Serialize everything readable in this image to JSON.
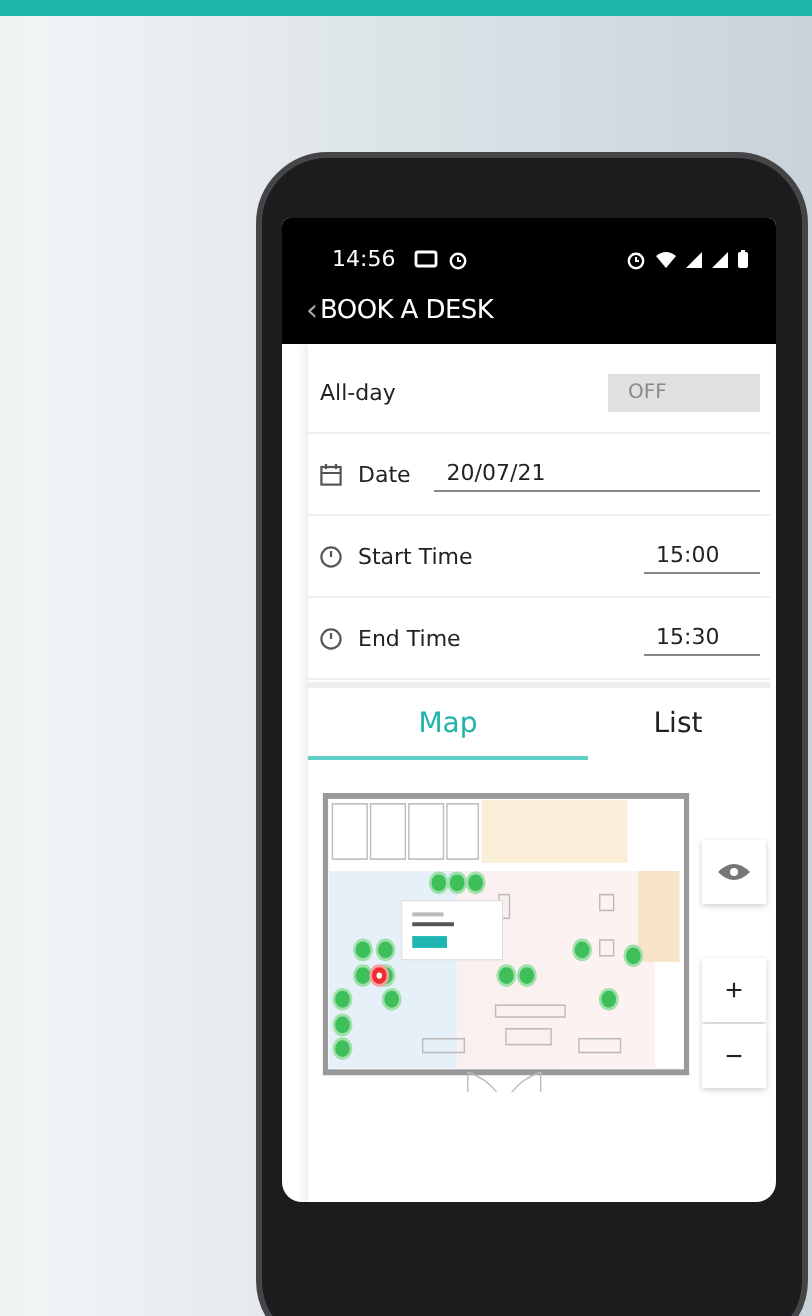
{
  "status_bar": {
    "time": "14:56"
  },
  "header": {
    "back": "‹",
    "title": "BOOK A DESK"
  },
  "form": {
    "all_day": {
      "label": "All-day",
      "toggle_text": "OFF",
      "on": false
    },
    "fields": [
      {
        "kind": "date",
        "label": "Date",
        "value": "20/07/21"
      },
      {
        "kind": "time",
        "label": "Start Time",
        "value": "15:00"
      },
      {
        "kind": "time",
        "label": "End Time",
        "value": "15:30"
      }
    ]
  },
  "tabs": [
    {
      "label": "Map",
      "selected": true
    },
    {
      "label": "List",
      "selected": false
    }
  ],
  "map_controls": {
    "zoom_in": "+",
    "zoom_out": "−"
  }
}
